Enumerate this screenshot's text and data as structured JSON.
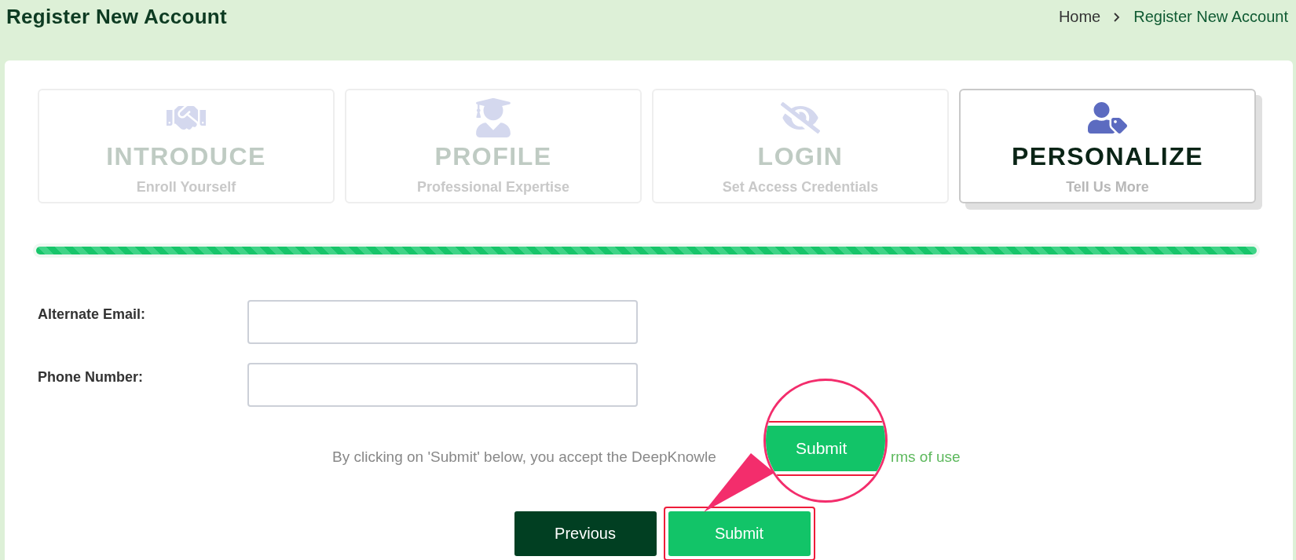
{
  "header": {
    "title": "Register New Account",
    "breadcrumb": [
      {
        "label": "Home",
        "selected": false
      },
      {
        "label": "Register New Account",
        "selected": true
      }
    ]
  },
  "steps": [
    {
      "kind": "handshake",
      "title": "INTRODUCE",
      "subtitle": "Enroll Yourself",
      "selected": false
    },
    {
      "kind": "graduate",
      "title": "PROFILE",
      "subtitle": "Professional Expertise",
      "selected": false
    },
    {
      "kind": "hidden",
      "title": "LOGIN",
      "subtitle": "Set Access Credentials",
      "selected": false
    },
    {
      "kind": "usertag",
      "title": "PERSONALIZE",
      "subtitle": "Tell Us More",
      "selected": true
    }
  ],
  "progress": {
    "level": 1
  },
  "fields": [
    {
      "label": "Alternate Email:"
    },
    {
      "label": "Phone Number:"
    }
  ],
  "terms": {
    "text": "By clicking on 'Submit' below, you accept the DeepKnowle",
    "link": "rms of use"
  },
  "buttons": [
    {
      "label": "Previous",
      "kind": "secondary",
      "highlighted": false
    },
    {
      "label": "Submit",
      "kind": "primary",
      "highlighted": true
    }
  ],
  "magnifier": {
    "button_label": "Submit"
  }
}
